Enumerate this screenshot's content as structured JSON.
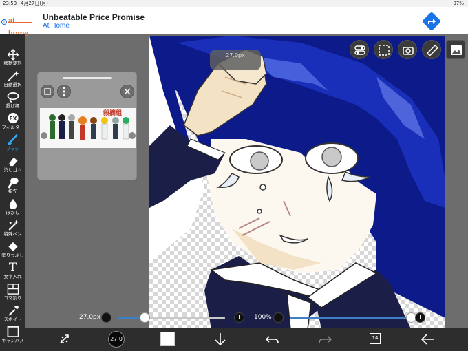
{
  "status_bar": {
    "time": "23:53",
    "date": "4月27日(月)",
    "battery": "97%"
  },
  "ad": {
    "logo": "at home",
    "info": "i",
    "title": "Unbeatable Price Promise",
    "subtitle": "At Home",
    "action_icon": "directions-arrow-icon"
  },
  "toolbar": {
    "items": [
      {
        "label": "移動変形",
        "icon": "move-transform-icon"
      },
      {
        "label": "自動選択",
        "icon": "magic-wand-icon"
      },
      {
        "label": "投げ縄",
        "icon": "lasso-icon"
      },
      {
        "label": "フィルター",
        "icon": "fx-filter-icon"
      },
      {
        "label": "ブラシ",
        "icon": "brush-icon",
        "active": true
      },
      {
        "label": "消しゴム",
        "icon": "eraser-icon"
      },
      {
        "label": "指先",
        "icon": "finger-icon"
      },
      {
        "label": "ぼかし",
        "icon": "blur-drop-icon"
      },
      {
        "label": "特殊ペン",
        "icon": "special-pen-icon"
      },
      {
        "label": "塗りつぶし",
        "icon": "fill-bucket-icon"
      },
      {
        "label": "文字入れ",
        "icon": "text-icon"
      },
      {
        "label": "コマ割り",
        "icon": "frame-divider-icon"
      },
      {
        "label": "スポイト",
        "icon": "eyedropper-icon"
      },
      {
        "label": "キャンバス",
        "icon": "canvas-icon"
      }
    ],
    "fx_text": "FX",
    "text_tool_glyph": "T"
  },
  "reference": {
    "thumb_title": "殺摘組"
  },
  "size_pill": {
    "value": "27.0px"
  },
  "sliders": {
    "brush_size": {
      "label": "27.0px",
      "minus": "−",
      "plus": "+",
      "level": 0.25
    },
    "opacity": {
      "label": "100%",
      "minus": "−",
      "plus": "+",
      "level": 1.0
    }
  },
  "bottom": {
    "brush_size_label": "27.0",
    "layer_count": "14"
  },
  "colors": {
    "accent": "#33a7f2",
    "toolbar": "#2d2d2d",
    "hair": "#0c1a8a",
    "uniform": "#1b1f47"
  }
}
